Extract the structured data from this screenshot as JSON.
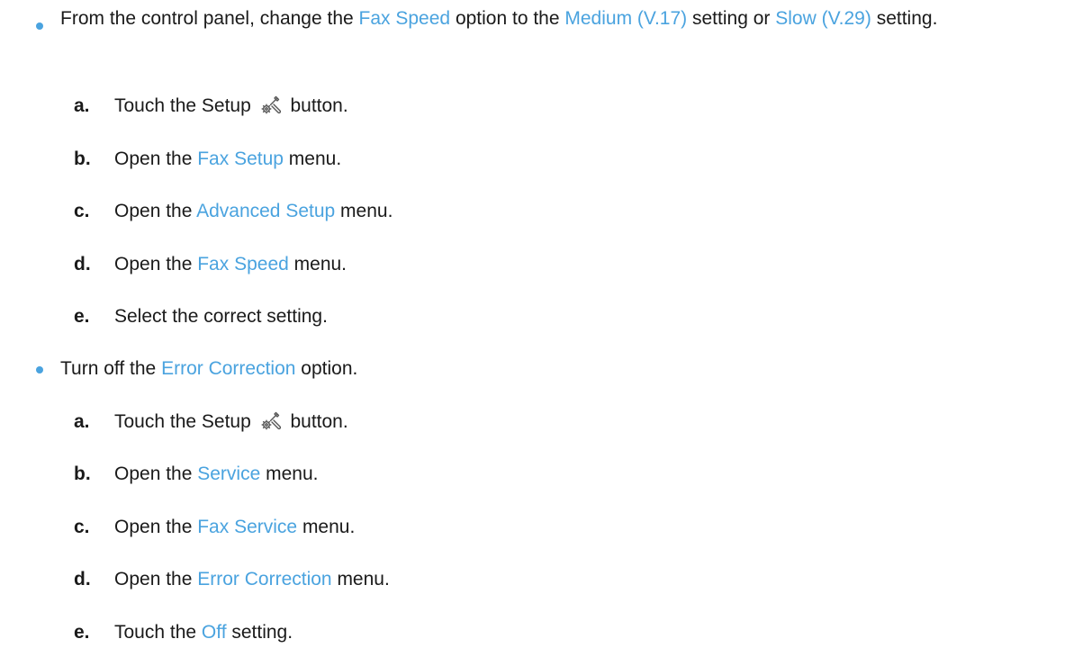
{
  "bullets": [
    {
      "parts": [
        {
          "text": "From the control panel, change the ",
          "term": false
        },
        {
          "text": "Fax Speed",
          "term": true
        },
        {
          "text": " option to the ",
          "term": false
        },
        {
          "text": "Medium (V.17)",
          "term": true
        },
        {
          "text": " setting or ",
          "term": false
        },
        {
          "text": "Slow (V.29)",
          "term": true
        },
        {
          "text": " setting.",
          "term": false
        }
      ],
      "steps": [
        {
          "letter": "a.",
          "parts": [
            {
              "text": "Touch the Setup ",
              "term": false
            },
            {
              "icon": "setup-icon"
            },
            {
              "text": " button.",
              "term": false
            }
          ]
        },
        {
          "letter": "b.",
          "parts": [
            {
              "text": "Open the ",
              "term": false
            },
            {
              "text": "Fax Setup",
              "term": true
            },
            {
              "text": " menu.",
              "term": false
            }
          ]
        },
        {
          "letter": "c.",
          "parts": [
            {
              "text": "Open the ",
              "term": false
            },
            {
              "text": "Advanced Setup",
              "term": true
            },
            {
              "text": " menu.",
              "term": false
            }
          ]
        },
        {
          "letter": "d.",
          "parts": [
            {
              "text": "Open the ",
              "term": false
            },
            {
              "text": "Fax Speed",
              "term": true
            },
            {
              "text": " menu.",
              "term": false
            }
          ]
        },
        {
          "letter": "e.",
          "parts": [
            {
              "text": "Select the correct setting.",
              "term": false
            }
          ]
        }
      ]
    },
    {
      "parts": [
        {
          "text": "Turn off the ",
          "term": false
        },
        {
          "text": "Error Correction",
          "term": true
        },
        {
          "text": " option.",
          "term": false
        }
      ],
      "steps": [
        {
          "letter": "a.",
          "parts": [
            {
              "text": "Touch the Setup ",
              "term": false
            },
            {
              "icon": "setup-icon"
            },
            {
              "text": " button.",
              "term": false
            }
          ]
        },
        {
          "letter": "b.",
          "parts": [
            {
              "text": "Open the ",
              "term": false
            },
            {
              "text": "Service",
              "term": true
            },
            {
              "text": " menu.",
              "term": false
            }
          ]
        },
        {
          "letter": "c.",
          "parts": [
            {
              "text": "Open the ",
              "term": false
            },
            {
              "text": "Fax Service",
              "term": true
            },
            {
              "text": " menu.",
              "term": false
            }
          ]
        },
        {
          "letter": "d.",
          "parts": [
            {
              "text": "Open the ",
              "term": false
            },
            {
              "text": "Error Correction",
              "term": true
            },
            {
              "text": " menu.",
              "term": false
            }
          ]
        },
        {
          "letter": "e.",
          "parts": [
            {
              "text": "Touch the ",
              "term": false
            },
            {
              "text": "Off",
              "term": true
            },
            {
              "text": " setting.",
              "term": false
            }
          ]
        }
      ]
    }
  ],
  "colors": {
    "term": "#4aa3df",
    "bullet": "#4aa3df",
    "text": "#1a1a1a"
  }
}
